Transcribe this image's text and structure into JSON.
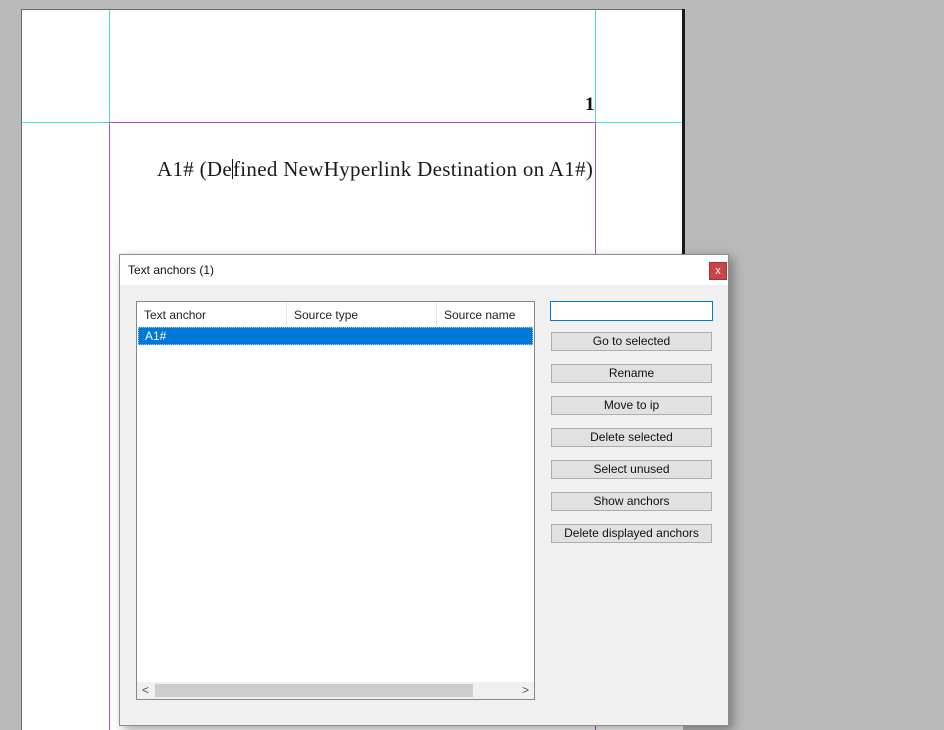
{
  "document": {
    "page_number": "1",
    "body_text_before_caret": "A1# (De",
    "body_text_after_caret": "fined NewHyperlink Destination on A1#)"
  },
  "dialog": {
    "title": "Text anchors (1)",
    "close_label": "x",
    "list": {
      "columns": [
        "Text anchor",
        "Source type",
        "Source name"
      ],
      "rows": [
        {
          "anchor": "A1#",
          "source_type": "",
          "source_name": "",
          "selected": true
        }
      ]
    },
    "search": {
      "value": ""
    },
    "buttons": {
      "go_to_selected": "Go to selected",
      "rename": "Rename",
      "move_to_ip": "Move to ip",
      "delete_selected": "Delete selected",
      "select_unused": "Select unused",
      "show_anchors": "Show anchors",
      "delete_displayed": "Delete displayed anchors"
    },
    "scroll_left": "<",
    "scroll_right": ">"
  },
  "colors": {
    "selection": "#0078d7",
    "guide_cyan": "#3fe0e0",
    "guide_magenta": "#b34cc7",
    "close_red": "#c74548"
  }
}
